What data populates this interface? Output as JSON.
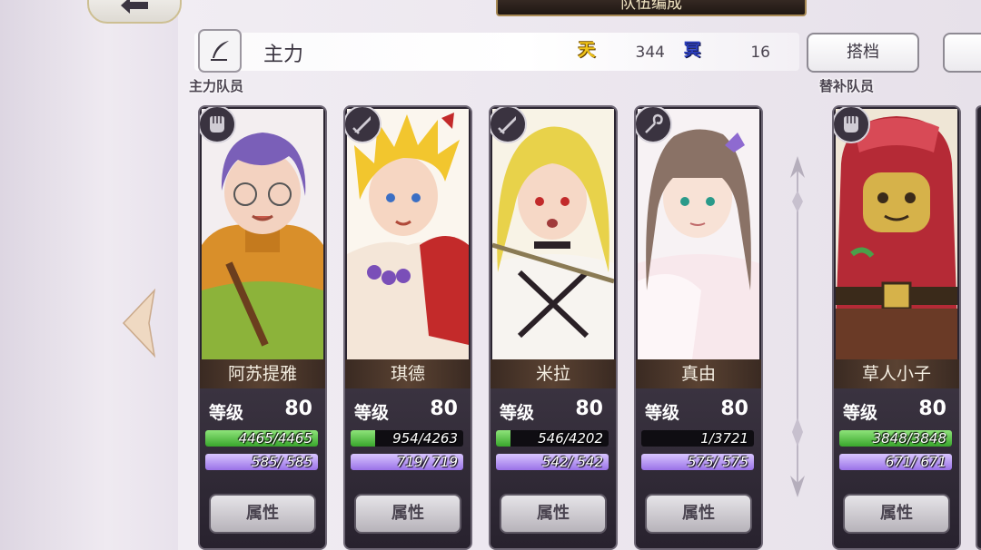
{
  "header": {
    "title": "队伍编成",
    "back_icon": "back-arrow-icon",
    "partner_label": "搭档"
  },
  "party": {
    "name": "主力",
    "heaven_icon": "天",
    "heaven_value": "344",
    "hell_icon": "冥",
    "hell_value": "16"
  },
  "sections": {
    "main_label": "主力队员",
    "reserve_label": "替补队员"
  },
  "labels": {
    "level": "等级",
    "attribute_button": "属性"
  },
  "colors": {
    "hp_bar": "#5cc44a",
    "mp_bar": "#b89af5",
    "name_plate": "#4a3628",
    "card_frame": "#2a2430"
  },
  "members": [
    {
      "name": "阿苏提雅",
      "class_icon": "fist-icon",
      "level": "80",
      "hp": "4465/4465",
      "hp_fraction": 1.0,
      "mp": "585/ 585",
      "mp_fraction": 1.0
    },
    {
      "name": "琪德",
      "class_icon": "sword-icon",
      "level": "80",
      "hp": "954/4263",
      "hp_fraction": 0.22,
      "mp": "719/ 719",
      "mp_fraction": 1.0
    },
    {
      "name": "米拉",
      "class_icon": "sword-icon",
      "level": "80",
      "hp": "546/4202",
      "hp_fraction": 0.13,
      "mp": "542/ 542",
      "mp_fraction": 1.0
    },
    {
      "name": "真由",
      "class_icon": "staff-icon",
      "level": "80",
      "hp": "1/3721",
      "hp_fraction": 0.0,
      "mp": "575/ 575",
      "mp_fraction": 1.0
    }
  ],
  "reserves": [
    {
      "name": "草人小子",
      "class_icon": "fist-icon",
      "level": "80",
      "hp": "3848/3848",
      "hp_fraction": 1.0,
      "mp": "671/ 671",
      "mp_fraction": 1.0
    }
  ]
}
